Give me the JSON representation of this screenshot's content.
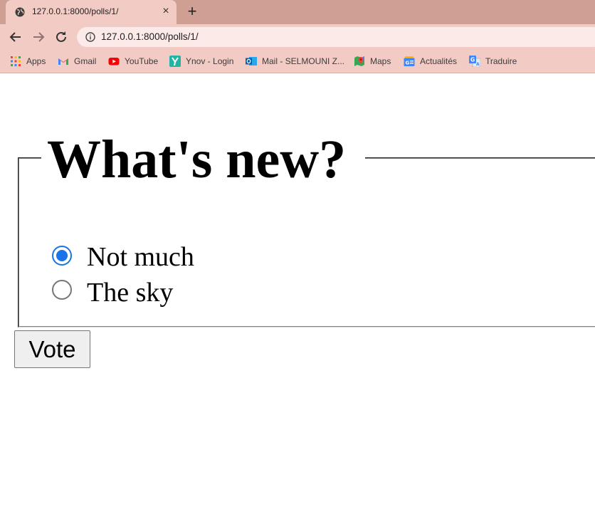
{
  "browser": {
    "tab": {
      "title": "127.0.0.1:8000/polls/1/",
      "close_glyph": "×"
    },
    "new_tab_glyph": "+",
    "address": {
      "url": "127.0.0.1:8000/polls/1/"
    },
    "bookmarks": [
      {
        "label": "Apps",
        "icon": "apps-grid-icon"
      },
      {
        "label": "Gmail",
        "icon": "gmail-icon"
      },
      {
        "label": "YouTube",
        "icon": "youtube-icon"
      },
      {
        "label": "Ynov - Login",
        "icon": "ynov-icon"
      },
      {
        "label": "Mail - SELMOUNI Z...",
        "icon": "outlook-mail-icon"
      },
      {
        "label": "Maps",
        "icon": "maps-icon"
      },
      {
        "label": "Actualités",
        "icon": "news-icon"
      },
      {
        "label": "Traduire",
        "icon": "translate-icon"
      }
    ]
  },
  "poll": {
    "question": "What's new?",
    "choices": [
      {
        "label": "Not much",
        "selected": true
      },
      {
        "label": "The sky",
        "selected": false
      }
    ],
    "vote_label": "Vote"
  },
  "colors": {
    "tabstrip": "#cf9f93",
    "toolbar": "#f2cbc4",
    "radio_accent": "#1a73e8"
  }
}
